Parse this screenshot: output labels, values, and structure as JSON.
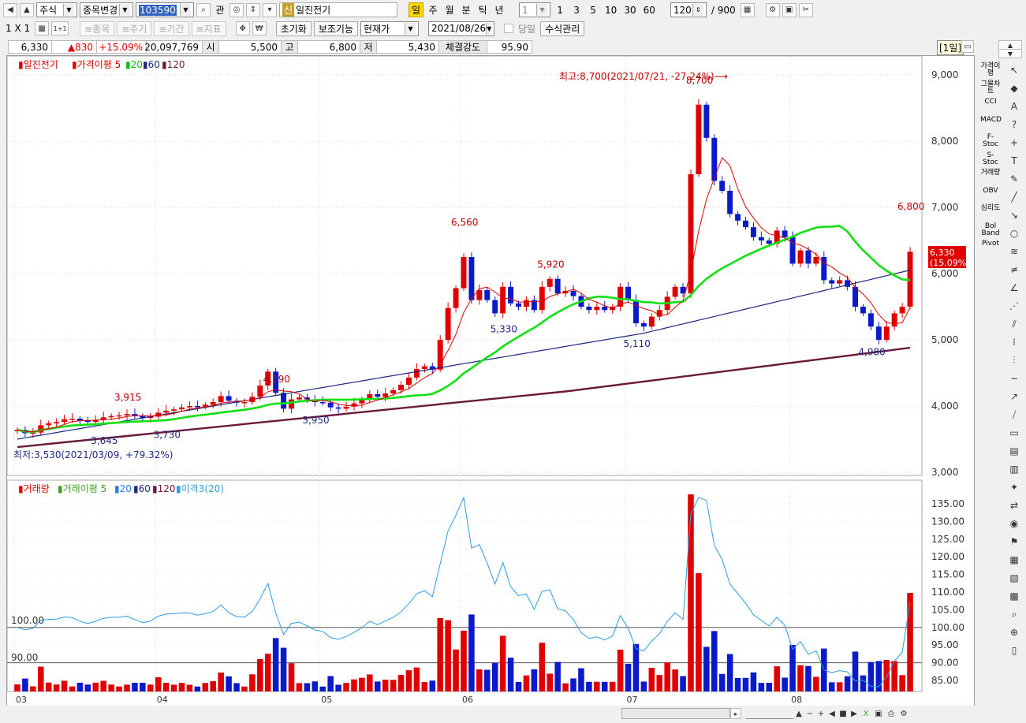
{
  "toolbar": {
    "market": "주식",
    "change_item": "종목변경",
    "code": "103590",
    "gwan": "관",
    "sin": "신",
    "stock_name": "일진전기",
    "periods": [
      "일",
      "주",
      "월",
      "분",
      "틱",
      "년"
    ],
    "interval": "1",
    "quick_counts": [
      "1",
      "3",
      "5",
      "10",
      "30",
      "60"
    ],
    "count_value": "120",
    "count_total": "/ 900"
  },
  "toolbar2": {
    "layout": "1 X 1",
    "one_plus_one": "1+1",
    "stock_btn": "≡종목",
    "period_btn": "≡주기",
    "range_btn": "≡기간",
    "indicator_btn": "≡지표",
    "reset_btn": "초기화",
    "aux_btn": "보조기능",
    "current_price": "현재가",
    "date": "2021/08/26",
    "today_label": "당일",
    "formula_btn": "수식관리"
  },
  "infobar": {
    "price": "6,330",
    "change": "▲830",
    "pct": "+15.09%",
    "volume": "20,097,769",
    "open_label": "시",
    "open": "5,500",
    "high_label": "고",
    "high": "6,800",
    "low_label": "저",
    "low": "5,430",
    "strength_label": "체결강도",
    "strength": "95.90"
  },
  "period_badge": "[1일]",
  "colors": {
    "up": "#e00000",
    "down": "#0a1acb",
    "ma5": "#e00000",
    "ma20": "#10e010",
    "ma60": "#1c2a80",
    "ma120": "#6a1a3a",
    "disparity": "#2a9de0"
  },
  "chart_data": [
    {
      "type": "candlestick",
      "legend": [
        "일진전기",
        "가격이평 5",
        "20",
        "60",
        "120"
      ],
      "y_ticks": [
        "9,000",
        "8,000",
        "7,000",
        "6,000",
        "5,000",
        "4,000",
        "3,000"
      ],
      "ylim": [
        3000,
        9200
      ],
      "x_ticks": [
        "03",
        "04",
        "05",
        "06",
        "07",
        "08"
      ],
      "current_label": "6,330",
      "current_pct": "(15.09%)",
      "annotations": {
        "high_note": "최고:8,700(2021/07/21, -27.24%)⟶",
        "low_note": "최저:3,530(2021/03/09, +79.32%)",
        "peaks": [
          "3,915",
          "4,190",
          "6,560",
          "5,920",
          "8,700",
          "6,800"
        ],
        "troughs": [
          "3,645",
          "3,730",
          "3,950",
          "5,330",
          "5,110",
          "4,980"
        ]
      },
      "close": [
        3640,
        3590,
        3600,
        3710,
        3740,
        3760,
        3800,
        3810,
        3780,
        3760,
        3790,
        3830,
        3850,
        3860,
        3880,
        3850,
        3820,
        3840,
        3900,
        3930,
        3950,
        3980,
        4000,
        3990,
        4020,
        4060,
        4150,
        4080,
        4050,
        4060,
        4140,
        4310,
        4520,
        4200,
        3960,
        4100,
        4130,
        4100,
        4060,
        4050,
        3980,
        3960,
        3990,
        4040,
        4100,
        4180,
        4140,
        4190,
        4240,
        4320,
        4430,
        4560,
        4600,
        4550,
        5000,
        5480,
        5780,
        6250,
        5600,
        5750,
        5600,
        5400,
        5800,
        5550,
        5500,
        5600,
        5450,
        5800,
        5920,
        5700,
        5740,
        5660,
        5500,
        5450,
        5500,
        5450,
        5500,
        5800,
        5600,
        5250,
        5200,
        5350,
        5450,
        5650,
        5800,
        5700,
        7500,
        8550,
        8050,
        7400,
        7250,
        6900,
        6800,
        6700,
        6550,
        6500,
        6450,
        6650,
        6550,
        6150,
        6350,
        6150,
        6250,
        5900,
        5850,
        5900,
        5800,
        5500,
        5400,
        5200,
        5000,
        5200,
        5400,
        5500,
        6330
      ],
      "volume_y_ticks": [
        "135.00",
        "130.00",
        "125.00",
        "120.00",
        "115.00",
        "110.00",
        "105.00",
        "100.00",
        "95.00",
        "90.00",
        "85.00"
      ],
      "volume_legend": [
        "거래량",
        "거래이평 5",
        "20",
        "60",
        "120",
        "이격3(20)"
      ],
      "level_labels": [
        "100.00",
        "90.00"
      ]
    }
  ],
  "sidebar": [
    "가격이평",
    "그물차트",
    "CCI",
    "MACD",
    "F-Stoc",
    "S-Stoc",
    "거래량",
    "OBV",
    "심리도",
    "Bol Band",
    "Pivot"
  ]
}
